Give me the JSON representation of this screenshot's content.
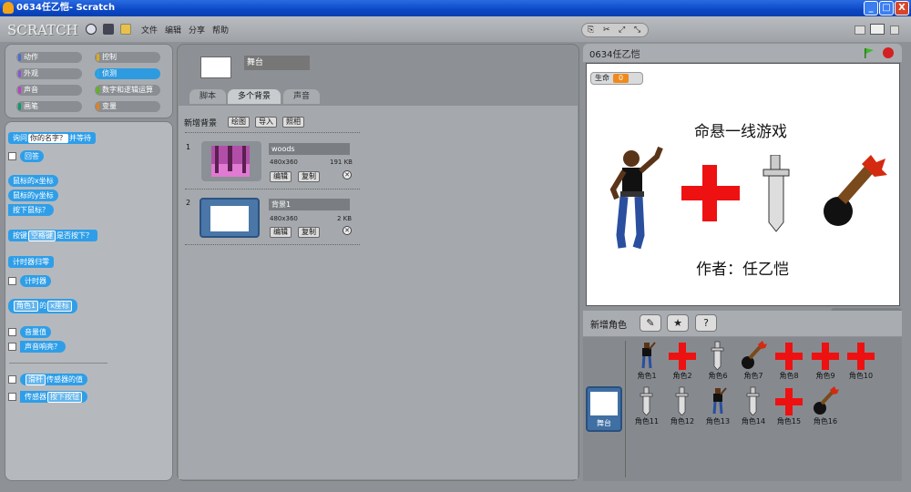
{
  "window": {
    "title": "0634任乙恺- Scratch",
    "min": "_",
    "max": "□",
    "close": "X"
  },
  "menu": {
    "logo": "SCRATCH",
    "file": "文件",
    "edit": "编辑",
    "share": "分享",
    "help": "帮助"
  },
  "categories": [
    {
      "label": "动作",
      "color": "#4a6cd4"
    },
    {
      "label": "控制",
      "color": "#e1a91a"
    },
    {
      "label": "外观",
      "color": "#8a55d7"
    },
    {
      "label": "侦测",
      "color": "#2ca5e2"
    },
    {
      "label": "声音",
      "color": "#bb42c3"
    },
    {
      "label": "数字和逻辑运算",
      "color": "#5cb712"
    },
    {
      "label": "画笔",
      "color": "#0e9a6c"
    },
    {
      "label": "变量",
      "color": "#ee7d16"
    }
  ],
  "blocks": {
    "ask": "询问",
    "ask_slot": "你的名字？",
    "ask_wait": "并等待",
    "answer": "回答",
    "mouse_x": "鼠标的x坐标",
    "mouse_y": "鼠标的y坐标",
    "mouse_down": "按下鼠标？",
    "key": "按键",
    "key_slot": "空格键",
    "key_pressed": "是否按下？",
    "timer_reset": "计时器归零",
    "timer": "计时器",
    "of_sprite": "角色1",
    "of": "的",
    "of_prop": "x座标",
    "loudness": "音量值",
    "loud": "声音响亮？",
    "slider": "滑杆",
    "sensor_val": "传感器的值",
    "sensor": "传感器",
    "button": "按下按钮"
  },
  "sprite": {
    "name": "舞台"
  },
  "tabs": [
    "脚本",
    "多个背景",
    "声音"
  ],
  "backgrounds": {
    "new_label": "新增背景",
    "paint": "绘图",
    "import": "导入",
    "camera": "照相",
    "items": [
      {
        "num": "1",
        "name": "woods",
        "dims": "480x360",
        "size": "191 KB",
        "edit": "编辑",
        "copy": "复制"
      },
      {
        "num": "2",
        "name": "背景1",
        "dims": "480x360",
        "size": "2 KB",
        "edit": "编辑",
        "copy": "复制"
      }
    ]
  },
  "stage": {
    "project_title": "0634任乙恺",
    "monitor_label": "生命",
    "monitor_value": "0",
    "game_title": "命悬一线游戏",
    "author": "作者：任乙恺",
    "coords": "x: -580   y: -376"
  },
  "sprites": {
    "new_label": "新增角色",
    "stage_label": "舞台",
    "items": [
      "角色1",
      "角色2",
      "角色6",
      "角色7",
      "角色8",
      "角色9",
      "角色10",
      "角色11",
      "角色12",
      "角色13",
      "角色14",
      "角色15",
      "角色16"
    ]
  }
}
